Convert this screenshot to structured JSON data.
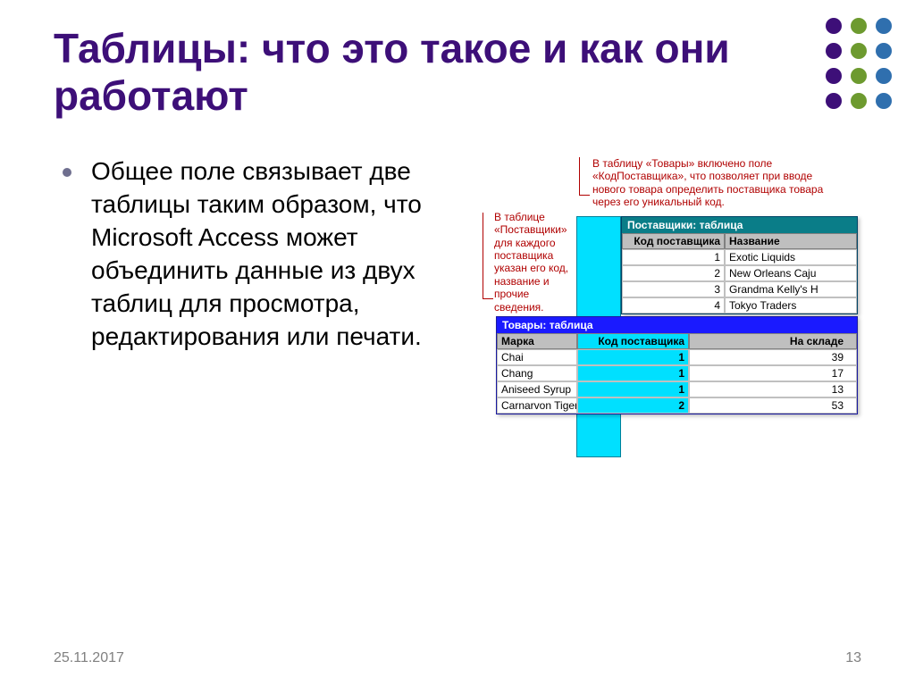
{
  "title": "Таблицы: что это такое и как они работают",
  "bullet": "Общее поле связывает две таблицы таким образом, что Microsoft Access может объединить данные из двух таблиц для просмотра, редактирования или печати.",
  "callout_top": "В таблицу «Товары» включено поле «КодПоставщика», что позволяет при вводе нового товара определить поставщика товара через его уникальный код.",
  "callout_left": "В таблице «Поставщики» для каждого поставщика указан его код, название и прочие сведения.",
  "suppliers": {
    "title": "Поставщики: таблица",
    "headers": {
      "code": "Код поставщика",
      "name": "Название"
    },
    "rows": [
      {
        "code": "1",
        "name": "Exotic Liquids"
      },
      {
        "code": "2",
        "name": "New Orleans Caju"
      },
      {
        "code": "3",
        "name": "Grandma Kelly's H"
      },
      {
        "code": "4",
        "name": "Tokyo Traders"
      }
    ]
  },
  "products": {
    "title": "Товары: таблица",
    "headers": {
      "brand": "Марка",
      "code": "Код поставщика",
      "stock": "На складе"
    },
    "rows": [
      {
        "brand": "Chai",
        "code": "1",
        "stock": "39"
      },
      {
        "brand": "Chang",
        "code": "1",
        "stock": "17"
      },
      {
        "brand": "Aniseed Syrup",
        "code": "1",
        "stock": "13"
      },
      {
        "brand": "Carnarvon Tigers",
        "code": "2",
        "stock": "53"
      }
    ]
  },
  "footer": {
    "date": "25.11.2017",
    "page": "13"
  }
}
